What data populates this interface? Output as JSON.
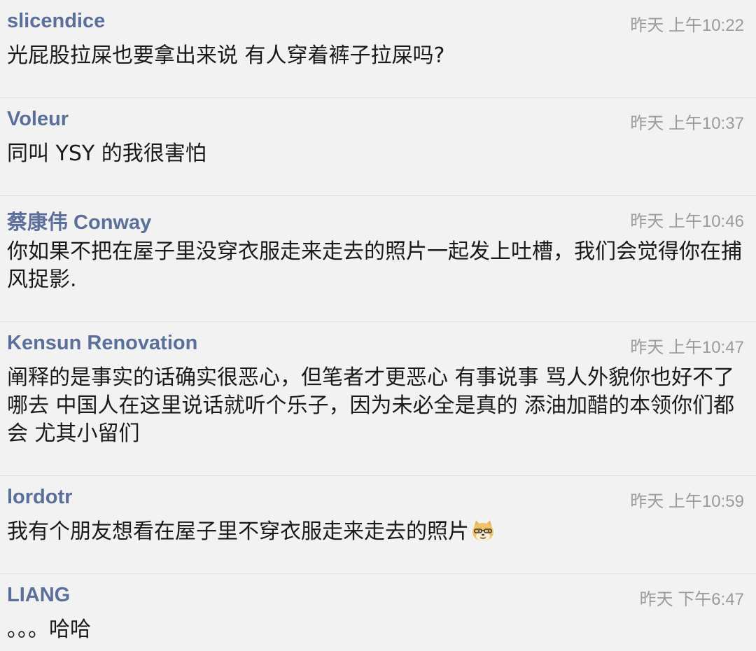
{
  "comments": [
    {
      "author": "slicendice",
      "time": "昨天 上午10:22",
      "text": "光屁股拉屎也要拿出来说 有人穿着裤子拉屎吗?"
    },
    {
      "author": "Voleur",
      "time": "昨天 上午10:37",
      "text": "同叫 YSY 的我很害怕"
    },
    {
      "author": "蔡康伟 Conway",
      "time": "昨天 上午10:46",
      "text": "你如果不把在屋子里没穿衣服走来走去的照片一起发上吐槽，我们会觉得你在捕风捉影."
    },
    {
      "author": "Kensun Renovation",
      "time": "昨天 上午10:47",
      "text": "阐释的是事实的话确实很恶心，但笔者才更恶心  有事说事  骂人外貌你也好不了哪去 中国人在这里说话就听个乐子，因为未必全是真的  添油加醋的本领你们都会  尤其小留们"
    },
    {
      "author": "lordotr",
      "time": "昨天 上午10:59",
      "text": "我有个朋友想看在屋子里不穿衣服走来走去的照片",
      "emoji": "doge-emoji-icon"
    },
    {
      "author": "LIANG",
      "time": "昨天 下午6:47",
      "text": "。。。哈哈"
    }
  ]
}
